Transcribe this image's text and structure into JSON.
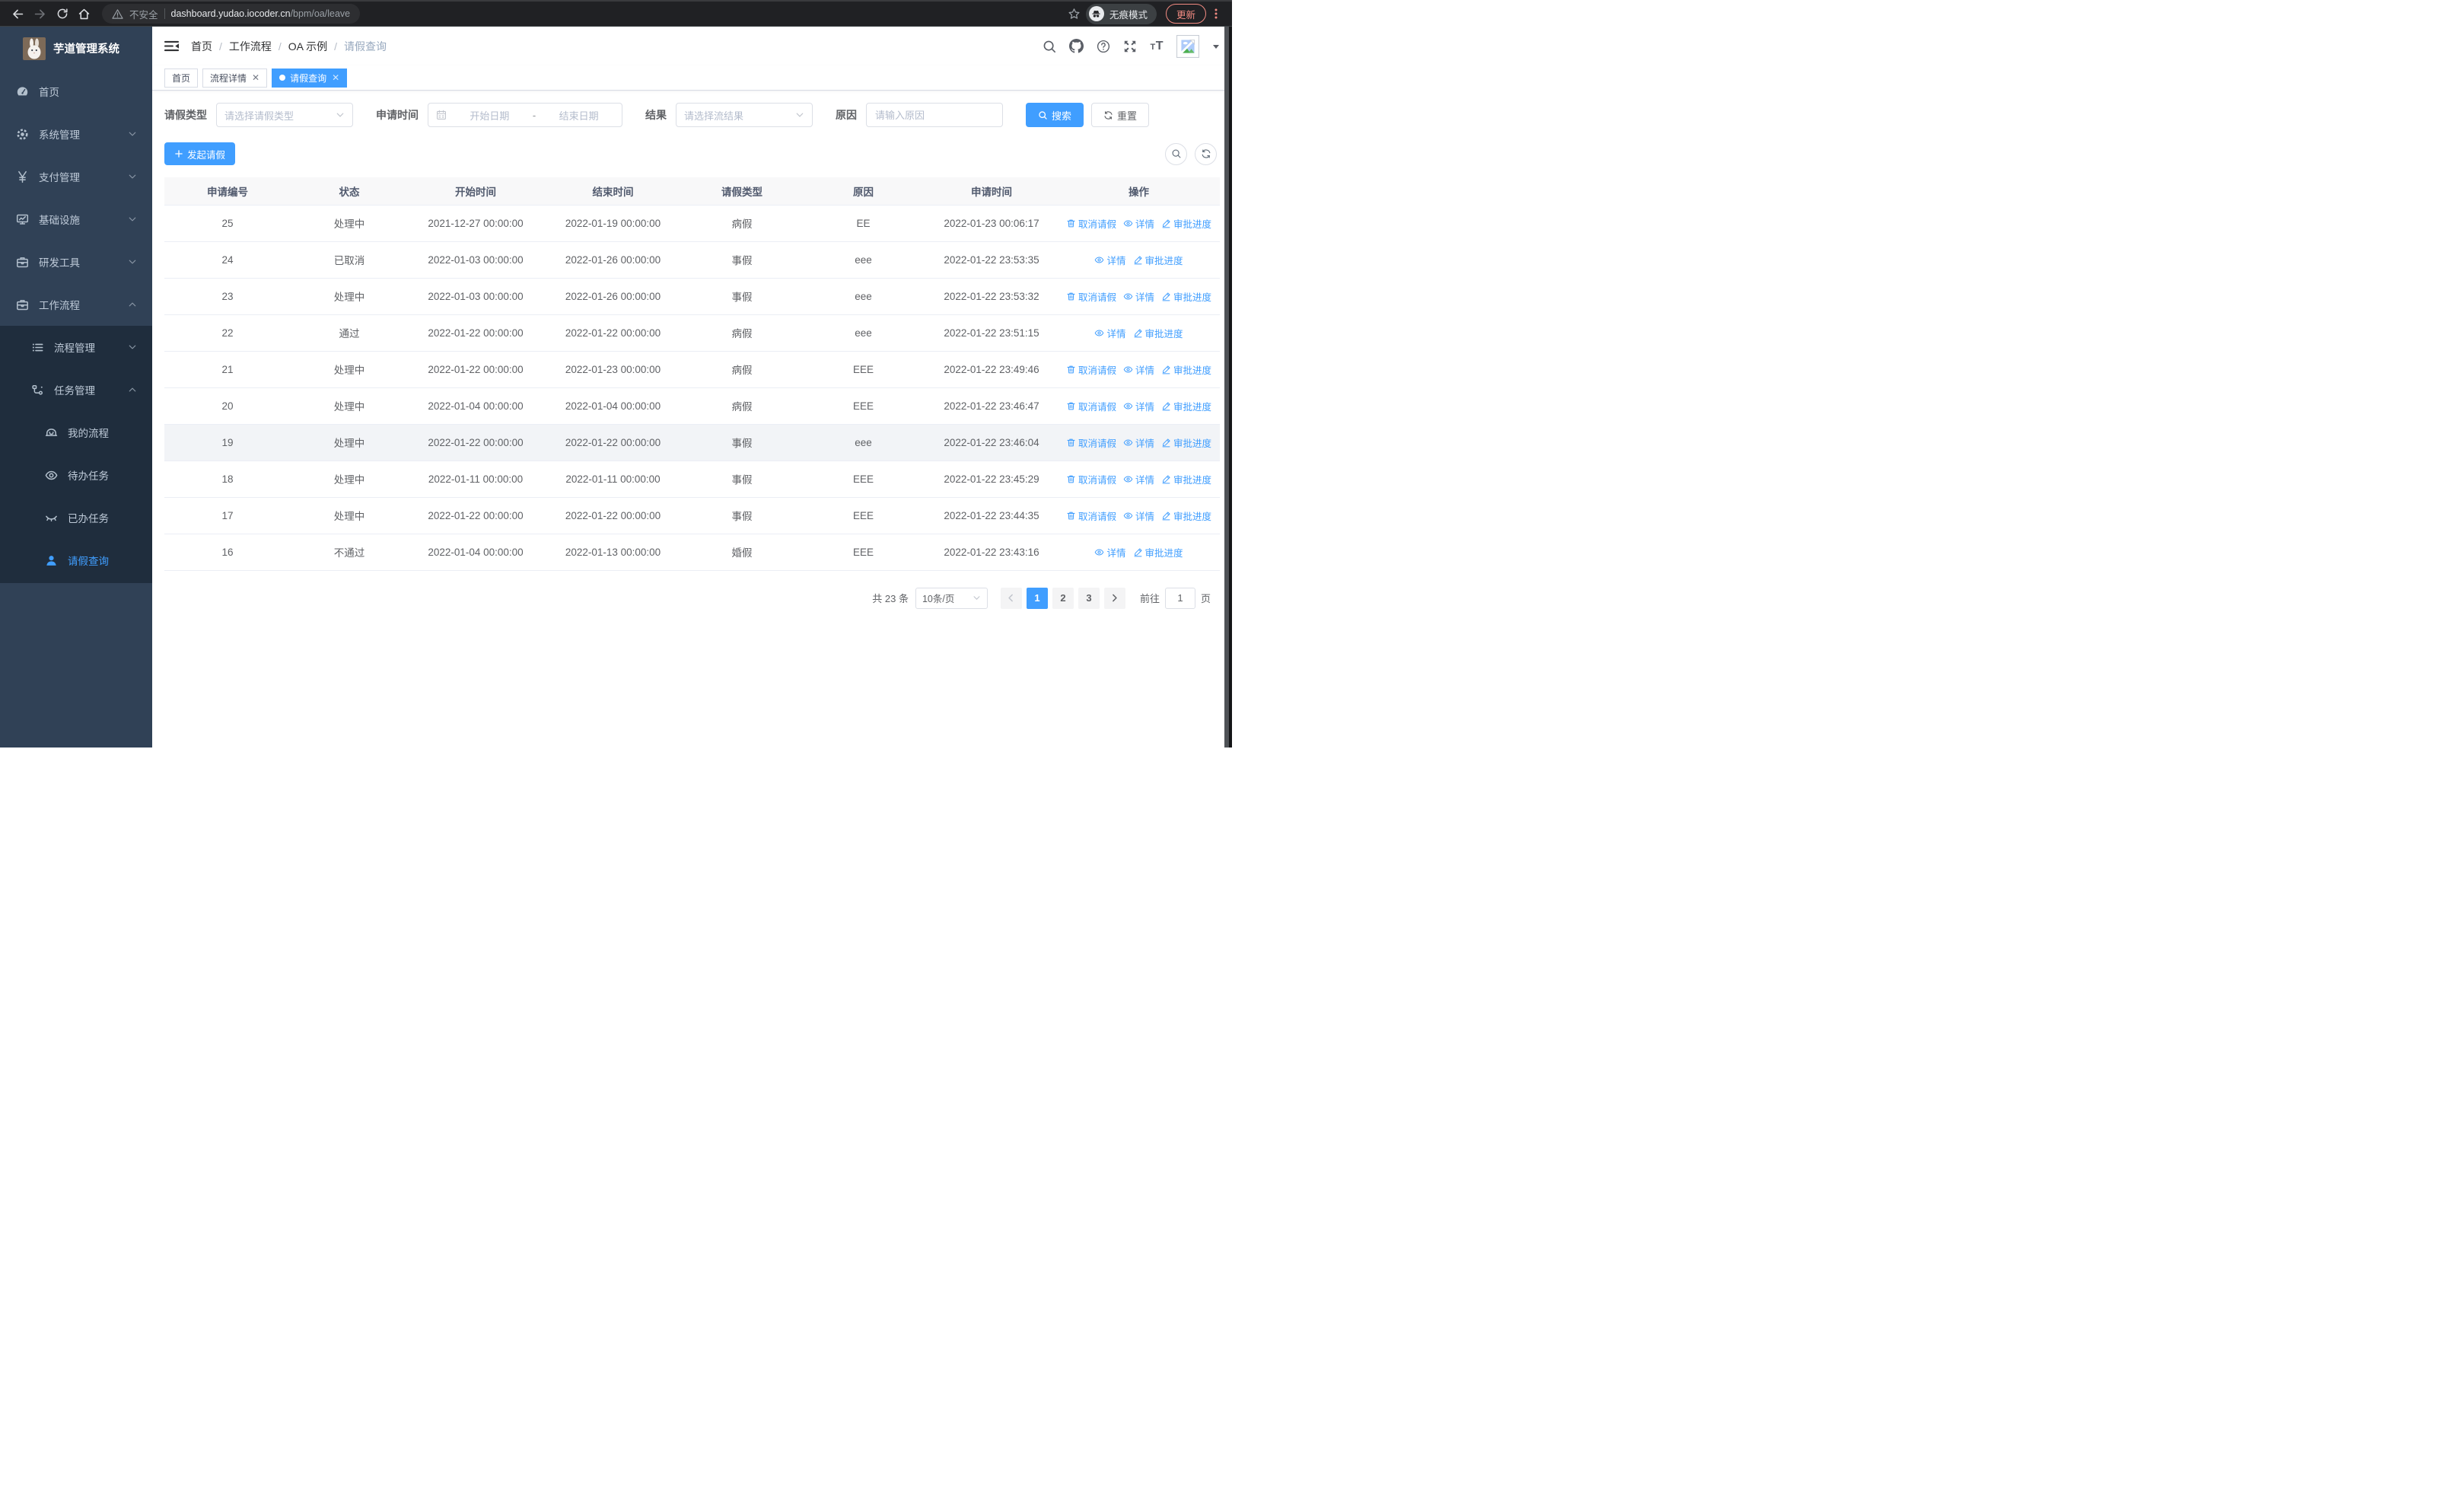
{
  "browser": {
    "security": "不安全",
    "url_host": "dashboard.yudao.iocoder.cn",
    "url_path": "/bpm/oa/leave",
    "incognito": "无痕模式",
    "update": "更新"
  },
  "colors": {
    "primary": "#409EFF",
    "sidebar_bg": "#304156",
    "submenu_bg": "#1f2d3d",
    "update_accent": "#F28B82"
  },
  "sidebar": {
    "title": "芋道管理系统",
    "menu": [
      {
        "label": "首页",
        "name": "home",
        "icon": "dashboard-icon",
        "level": 1,
        "sub": false,
        "chevron": null,
        "active": false
      },
      {
        "label": "系统管理",
        "name": "system-management",
        "icon": "gear-icon",
        "level": 1,
        "sub": false,
        "chevron": "down",
        "active": false
      },
      {
        "label": "支付管理",
        "name": "payment-management",
        "icon": "yen-icon",
        "level": 1,
        "sub": false,
        "chevron": "down",
        "active": false
      },
      {
        "label": "基础设施",
        "name": "infrastructure",
        "icon": "monitor-icon",
        "level": 1,
        "sub": false,
        "chevron": "down",
        "active": false
      },
      {
        "label": "研发工具",
        "name": "dev-tools",
        "icon": "toolbox-icon",
        "level": 1,
        "sub": false,
        "chevron": "down",
        "active": false
      },
      {
        "label": "工作流程",
        "name": "workflow",
        "icon": "toolbox-icon",
        "level": 1,
        "sub": false,
        "chevron": "up",
        "active": false
      },
      {
        "label": "流程管理",
        "name": "process-management",
        "icon": "list-icon",
        "level": 2,
        "sub": true,
        "chevron": "down",
        "active": false
      },
      {
        "label": "任务管理",
        "name": "task-management",
        "icon": "nodes-icon",
        "level": 2,
        "sub": true,
        "chevron": "up",
        "active": false
      },
      {
        "label": "我的流程",
        "name": "my-process",
        "icon": "robot-icon",
        "level": 3,
        "sub": true,
        "chevron": null,
        "active": false
      },
      {
        "label": "待办任务",
        "name": "todo-tasks",
        "icon": "eye-icon",
        "level": 3,
        "sub": true,
        "chevron": null,
        "active": false
      },
      {
        "label": "已办任务",
        "name": "done-tasks",
        "icon": "eye-closed-icon",
        "level": 3,
        "sub": true,
        "chevron": null,
        "active": false
      },
      {
        "label": "请假查询",
        "name": "leave-query",
        "icon": "user-icon",
        "level": 3,
        "sub": true,
        "chevron": null,
        "active": true
      }
    ]
  },
  "breadcrumb": [
    "首页",
    "工作流程",
    "OA 示例",
    "请假查询"
  ],
  "tabs": [
    {
      "label": "首页",
      "name": "tab-home",
      "closable": false,
      "active": false
    },
    {
      "label": "流程详情",
      "name": "tab-process-detail",
      "closable": true,
      "active": false
    },
    {
      "label": "请假查询",
      "name": "tab-leave-query",
      "closable": true,
      "active": true
    }
  ],
  "filters": {
    "type_label": "请假类型",
    "type_placeholder": "请选择请假类型",
    "time_label": "申请时间",
    "time_start_placeholder": "开始日期",
    "time_separator": "-",
    "time_end_placeholder": "结束日期",
    "result_label": "结果",
    "result_placeholder": "请选择流结果",
    "reason_label": "原因",
    "reason_placeholder": "请输入原因",
    "search_label": "搜索",
    "reset_label": "重置"
  },
  "toolbar": {
    "create_label": "发起请假"
  },
  "table": {
    "columns": [
      "申请编号",
      "状态",
      "开始时间",
      "结束时间",
      "请假类型",
      "原因",
      "申请时间",
      "操作"
    ],
    "action_labels": {
      "cancel": "取消请假",
      "detail": "详情",
      "progress": "审批进度"
    },
    "rows": [
      {
        "id": "25",
        "status": "处理中",
        "start": "2021-12-27 00:00:00",
        "end": "2022-01-19 00:00:00",
        "type": "病假",
        "reason": "EE",
        "apply": "2022-01-23 00:06:17",
        "actions": [
          "cancel",
          "detail",
          "progress"
        ],
        "hover": false
      },
      {
        "id": "24",
        "status": "已取消",
        "start": "2022-01-03 00:00:00",
        "end": "2022-01-26 00:00:00",
        "type": "事假",
        "reason": "eee",
        "apply": "2022-01-22 23:53:35",
        "actions": [
          "detail",
          "progress"
        ],
        "hover": false
      },
      {
        "id": "23",
        "status": "处理中",
        "start": "2022-01-03 00:00:00",
        "end": "2022-01-26 00:00:00",
        "type": "事假",
        "reason": "eee",
        "apply": "2022-01-22 23:53:32",
        "actions": [
          "cancel",
          "detail",
          "progress"
        ],
        "hover": false
      },
      {
        "id": "22",
        "status": "通过",
        "start": "2022-01-22 00:00:00",
        "end": "2022-01-22 00:00:00",
        "type": "病假",
        "reason": "eee",
        "apply": "2022-01-22 23:51:15",
        "actions": [
          "detail",
          "progress"
        ],
        "hover": false
      },
      {
        "id": "21",
        "status": "处理中",
        "start": "2022-01-22 00:00:00",
        "end": "2022-01-23 00:00:00",
        "type": "病假",
        "reason": "EEE",
        "apply": "2022-01-22 23:49:46",
        "actions": [
          "cancel",
          "detail",
          "progress"
        ],
        "hover": false
      },
      {
        "id": "20",
        "status": "处理中",
        "start": "2022-01-04 00:00:00",
        "end": "2022-01-04 00:00:00",
        "type": "病假",
        "reason": "EEE",
        "apply": "2022-01-22 23:46:47",
        "actions": [
          "cancel",
          "detail",
          "progress"
        ],
        "hover": false
      },
      {
        "id": "19",
        "status": "处理中",
        "start": "2022-01-22 00:00:00",
        "end": "2022-01-22 00:00:00",
        "type": "事假",
        "reason": "eee",
        "apply": "2022-01-22 23:46:04",
        "actions": [
          "cancel",
          "detail",
          "progress"
        ],
        "hover": true
      },
      {
        "id": "18",
        "status": "处理中",
        "start": "2022-01-11 00:00:00",
        "end": "2022-01-11 00:00:00",
        "type": "事假",
        "reason": "EEE",
        "apply": "2022-01-22 23:45:29",
        "actions": [
          "cancel",
          "detail",
          "progress"
        ],
        "hover": false
      },
      {
        "id": "17",
        "status": "处理中",
        "start": "2022-01-22 00:00:00",
        "end": "2022-01-22 00:00:00",
        "type": "事假",
        "reason": "EEE",
        "apply": "2022-01-22 23:44:35",
        "actions": [
          "cancel",
          "detail",
          "progress"
        ],
        "hover": false
      },
      {
        "id": "16",
        "status": "不通过",
        "start": "2022-01-04 00:00:00",
        "end": "2022-01-13 00:00:00",
        "type": "婚假",
        "reason": "EEE",
        "apply": "2022-01-22 23:43:16",
        "actions": [
          "detail",
          "progress"
        ],
        "hover": false
      }
    ]
  },
  "pagination": {
    "total_label": "共 23 条",
    "page_size_label": "10条/页",
    "pages": [
      "1",
      "2",
      "3"
    ],
    "current_page": "1",
    "goto_label": "前往",
    "goto_value": "1",
    "goto_unit": "页"
  }
}
